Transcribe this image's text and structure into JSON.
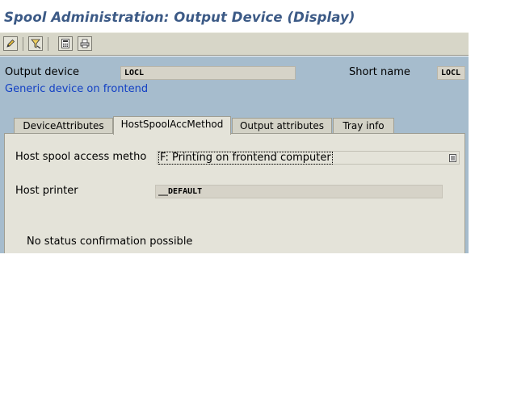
{
  "title": "Spool Administration: Output Device (Display)",
  "toolbar": {
    "buttons": [
      {
        "name": "change-display-button",
        "icon": "pencil-icon"
      },
      {
        "name": "filter-button",
        "icon": "funnel-icon"
      },
      {
        "name": "calculator-button",
        "icon": "calculator-icon"
      },
      {
        "name": "printer-button",
        "icon": "printer-icon"
      }
    ]
  },
  "header": {
    "output_device_label": "Output device",
    "output_device_value": "LOCL",
    "short_name_label": "Short name",
    "short_name_value": "LOCL",
    "description": "Generic device on frontend"
  },
  "tabs": [
    {
      "label": "DeviceAttributes",
      "active": false
    },
    {
      "label": "HostSpoolAccMethod",
      "active": true
    },
    {
      "label": "Output attributes",
      "active": false
    },
    {
      "label": "Tray info",
      "active": false
    }
  ],
  "panel": {
    "access_method_label": "Host spool access metho",
    "access_method_value": "F: Printing on frontend computer",
    "host_printer_label": "Host printer",
    "host_printer_value": "__DEFAULT",
    "status_text": "No status confirmation possible"
  },
  "colors": {
    "title": "#3c5a86",
    "background": "#a6bccd",
    "panel": "#e4e3d9",
    "description": "#1340c4"
  }
}
